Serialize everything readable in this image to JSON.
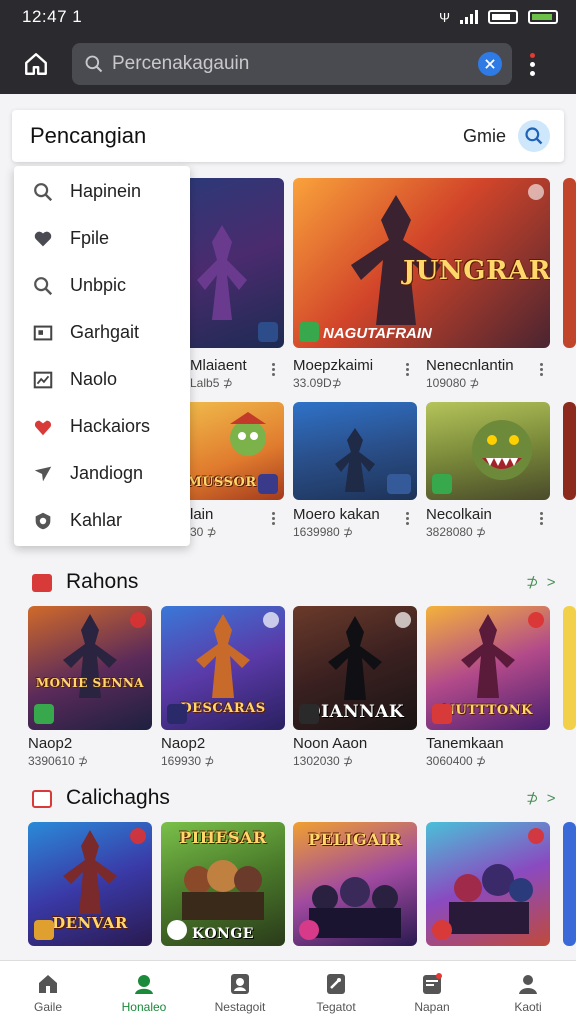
{
  "status_bar": {
    "time": "12:47 1"
  },
  "app_bar": {
    "search_placeholder": "Percenakagauin"
  },
  "header": {
    "title": "Pencangian",
    "game_label": "Gmie"
  },
  "dropdown": {
    "items": [
      {
        "label": "Hapinein",
        "icon": "search-icon"
      },
      {
        "label": "Fpile",
        "icon": "heart-icon"
      },
      {
        "label": "Unbpic",
        "icon": "search-icon"
      },
      {
        "label": "Garhgait",
        "icon": "picture-icon"
      },
      {
        "label": "Naolo",
        "icon": "chart-icon"
      },
      {
        "label": "Hackaiors",
        "icon": "heart-red-icon"
      },
      {
        "label": "Jandiogn",
        "icon": "send-icon"
      },
      {
        "label": "Kahlar",
        "icon": "shield-icon"
      }
    ]
  },
  "top_grid": {
    "row1": [
      {
        "name": "Mlaiaent",
        "meta": "Lalb5 ⊅",
        "cover": ""
      },
      {
        "name": "Moepzkaimi",
        "meta": "33.09D⊅",
        "cover": "JUNGRAR",
        "sub": "NAGUTAFRAIN"
      },
      {
        "name": "Nenecnlantin",
        "meta": "109080 ⊅",
        "cover": ""
      }
    ],
    "row2": [
      {
        "name": "lain",
        "meta": "30 ⊅",
        "cover": "MUSSOR"
      },
      {
        "name": "Moero kakan",
        "meta": "1639980 ⊅",
        "cover": ""
      },
      {
        "name": "Necolkain",
        "meta": "3828080 ⊅",
        "cover": ""
      }
    ]
  },
  "sections": [
    {
      "title": "Rahons",
      "more": "⊅ >",
      "games": [
        {
          "name": "Naop2",
          "meta": "3390610 ⊅",
          "cover": "MONIE SENNA"
        },
        {
          "name": "Naop2",
          "meta": "169930 ⊅",
          "cover": "DESCARAS"
        },
        {
          "name": "Noon Aaon",
          "meta": "1302030 ⊅",
          "cover": "DIANNAK"
        },
        {
          "name": "Tanemkaan",
          "meta": "3060400 ⊅",
          "cover": "NUTTTONK"
        }
      ]
    },
    {
      "title": "Calichaghs",
      "more": "⊅ >",
      "games": [
        {
          "name": "",
          "meta": "",
          "cover": "DENVAR"
        },
        {
          "name": "",
          "meta": "",
          "cover": "KONGE"
        },
        {
          "name": "",
          "meta": "",
          "cover": "PELIGAIR"
        },
        {
          "name": "",
          "meta": "",
          "cover": ""
        }
      ]
    }
  ],
  "bottom_nav": [
    {
      "label": "Gaile",
      "icon": "home-icon"
    },
    {
      "label": "Honaleo",
      "icon": "profile-icon"
    },
    {
      "label": "Nestagoit",
      "icon": "account-icon"
    },
    {
      "label": "Tegatot",
      "icon": "tag-icon"
    },
    {
      "label": "Napan",
      "icon": "notification-icon"
    },
    {
      "label": "Kaoti",
      "icon": "person-icon"
    }
  ],
  "colors": {
    "accent": "#1a8a3b",
    "app_bar": "#2b2b2f",
    "clear_button": "#2f7be6"
  }
}
